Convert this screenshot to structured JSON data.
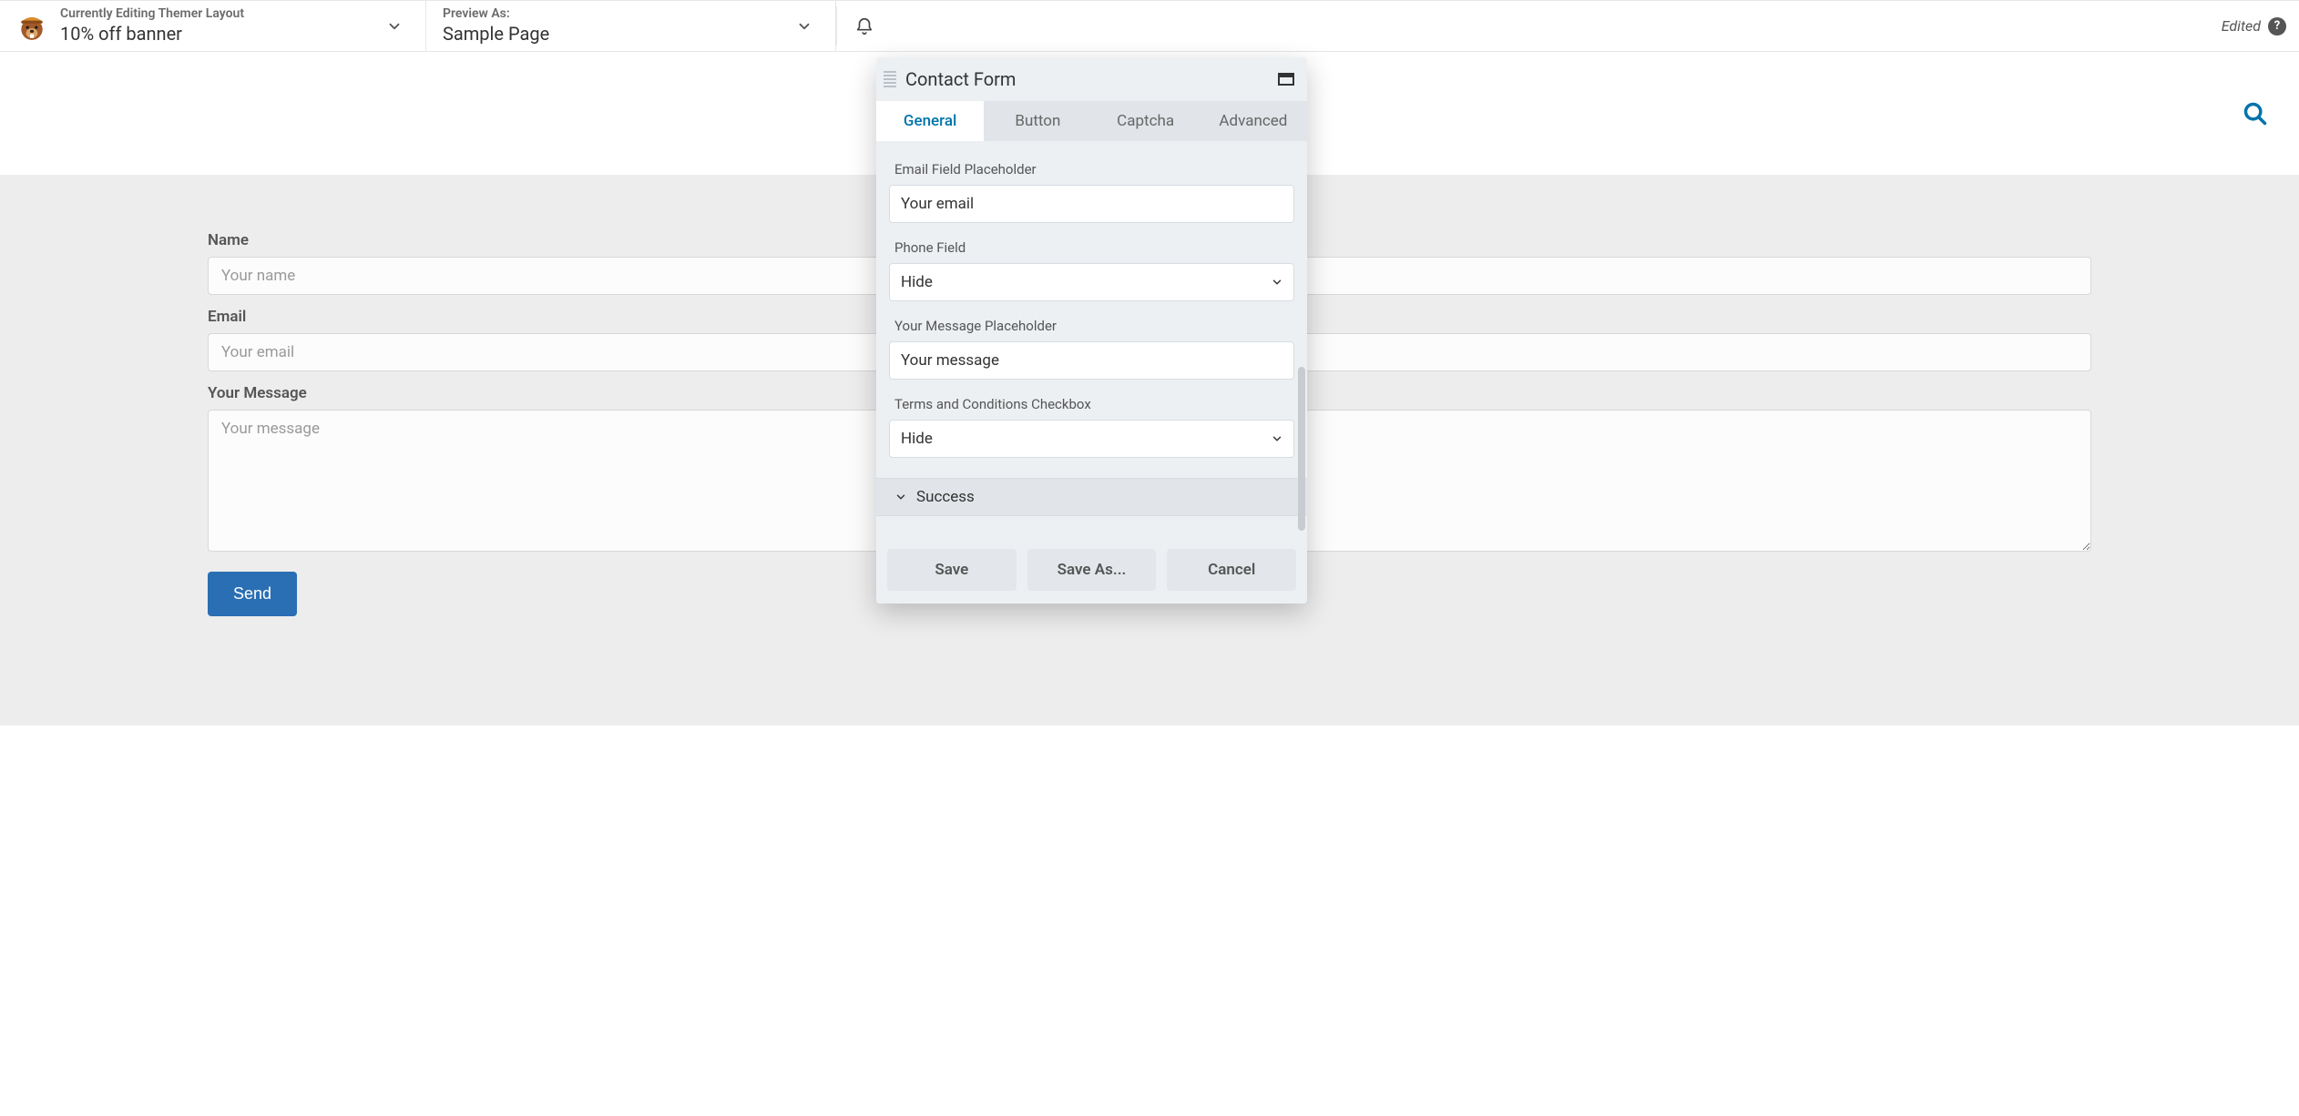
{
  "topbar": {
    "editing_eyebrow": "Currently Editing Themer Layout",
    "editing_title": "10% off banner",
    "preview_eyebrow": "Preview As:",
    "preview_title": "Sample Page",
    "status": "Edited"
  },
  "form": {
    "name_label": "Name",
    "name_placeholder": "Your name",
    "email_label": "Email",
    "email_placeholder": "Your email",
    "message_label": "Your Message",
    "message_placeholder": "Your message",
    "send_label": "Send"
  },
  "panel": {
    "title": "Contact Form",
    "tabs": {
      "general": "General",
      "button": "Button",
      "captcha": "Captcha",
      "advanced": "Advanced"
    },
    "fields": {
      "email_placeholder_label": "Email Field Placeholder",
      "email_placeholder_value": "Your email",
      "phone_field_label": "Phone Field",
      "phone_field_value": "Hide",
      "message_placeholder_label": "Your Message Placeholder",
      "message_placeholder_value": "Your message",
      "terms_label": "Terms and Conditions Checkbox",
      "terms_value": "Hide"
    },
    "accordion": {
      "success": "Success"
    },
    "footer": {
      "save": "Save",
      "save_as": "Save As...",
      "cancel": "Cancel"
    }
  }
}
